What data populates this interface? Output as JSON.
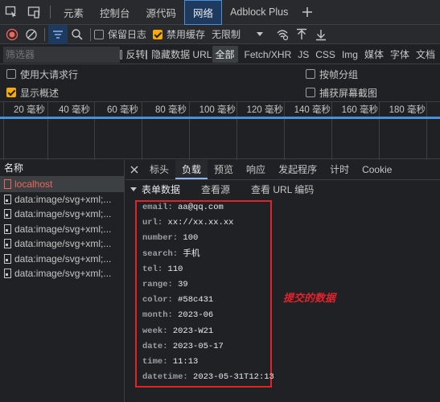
{
  "tabs": [
    "元素",
    "控制台",
    "源代码",
    "网络",
    "Adblock Plus"
  ],
  "toolbar": {
    "preserve_log": "保留日志",
    "disable_cache": "禁用缓存",
    "throttle": "无限制"
  },
  "filter": {
    "placeholder": "筛选器",
    "invert": "反转",
    "hide_data_url": "隐藏数据 URL",
    "types": [
      "全部",
      "Fetch/XHR",
      "JS",
      "CSS",
      "Img",
      "媒体",
      "字体",
      "文档"
    ]
  },
  "options": {
    "big_request_rows": "使用大请求行",
    "group_by_frame": "按帧分组",
    "show_overview": "显示概述",
    "capture_screenshots": "捕获屏幕截图"
  },
  "timeline": {
    "ticks": [
      "20 毫秒",
      "40 毫秒",
      "60 毫秒",
      "80 毫秒",
      "100 毫秒",
      "120 毫秒",
      "140 毫秒",
      "160 毫秒",
      "180 毫秒"
    ]
  },
  "list": {
    "header": "名称",
    "items": [
      "localhost",
      "data:image/svg+xml;...",
      "data:image/svg+xml;...",
      "data:image/svg+xml;...",
      "data:image/svg+xml;...",
      "data:image/svg+xml;...",
      "data:image/svg+xml;..."
    ]
  },
  "detail": {
    "tabs": [
      "标头",
      "负载",
      "预览",
      "响应",
      "发起程序",
      "计时",
      "Cookie"
    ],
    "form_data": "表单数据",
    "view_source": "查看源",
    "view_url_encoded": "查看 URL 编码",
    "fields": [
      {
        "k": "email:",
        "v": "aa@qq.com"
      },
      {
        "k": "url:",
        "v": "xx://xx.xx.xx"
      },
      {
        "k": "number:",
        "v": "100"
      },
      {
        "k": "search:",
        "v": "手机"
      },
      {
        "k": "tel:",
        "v": "110"
      },
      {
        "k": "range:",
        "v": "39"
      },
      {
        "k": "color:",
        "v": "#58c431"
      },
      {
        "k": "month:",
        "v": "2023-06"
      },
      {
        "k": "week:",
        "v": "2023-W21"
      },
      {
        "k": "date:",
        "v": "2023-05-17"
      },
      {
        "k": "time:",
        "v": "11:13"
      },
      {
        "k": "datetime:",
        "v": "2023-05-31T12:13"
      }
    ],
    "annotation": "提交的数据"
  },
  "colors": {
    "accent": "#4a90d9",
    "highlight_box": "#e0242c",
    "checkbox_on": "#f9ab00",
    "record": "#ee675c"
  }
}
